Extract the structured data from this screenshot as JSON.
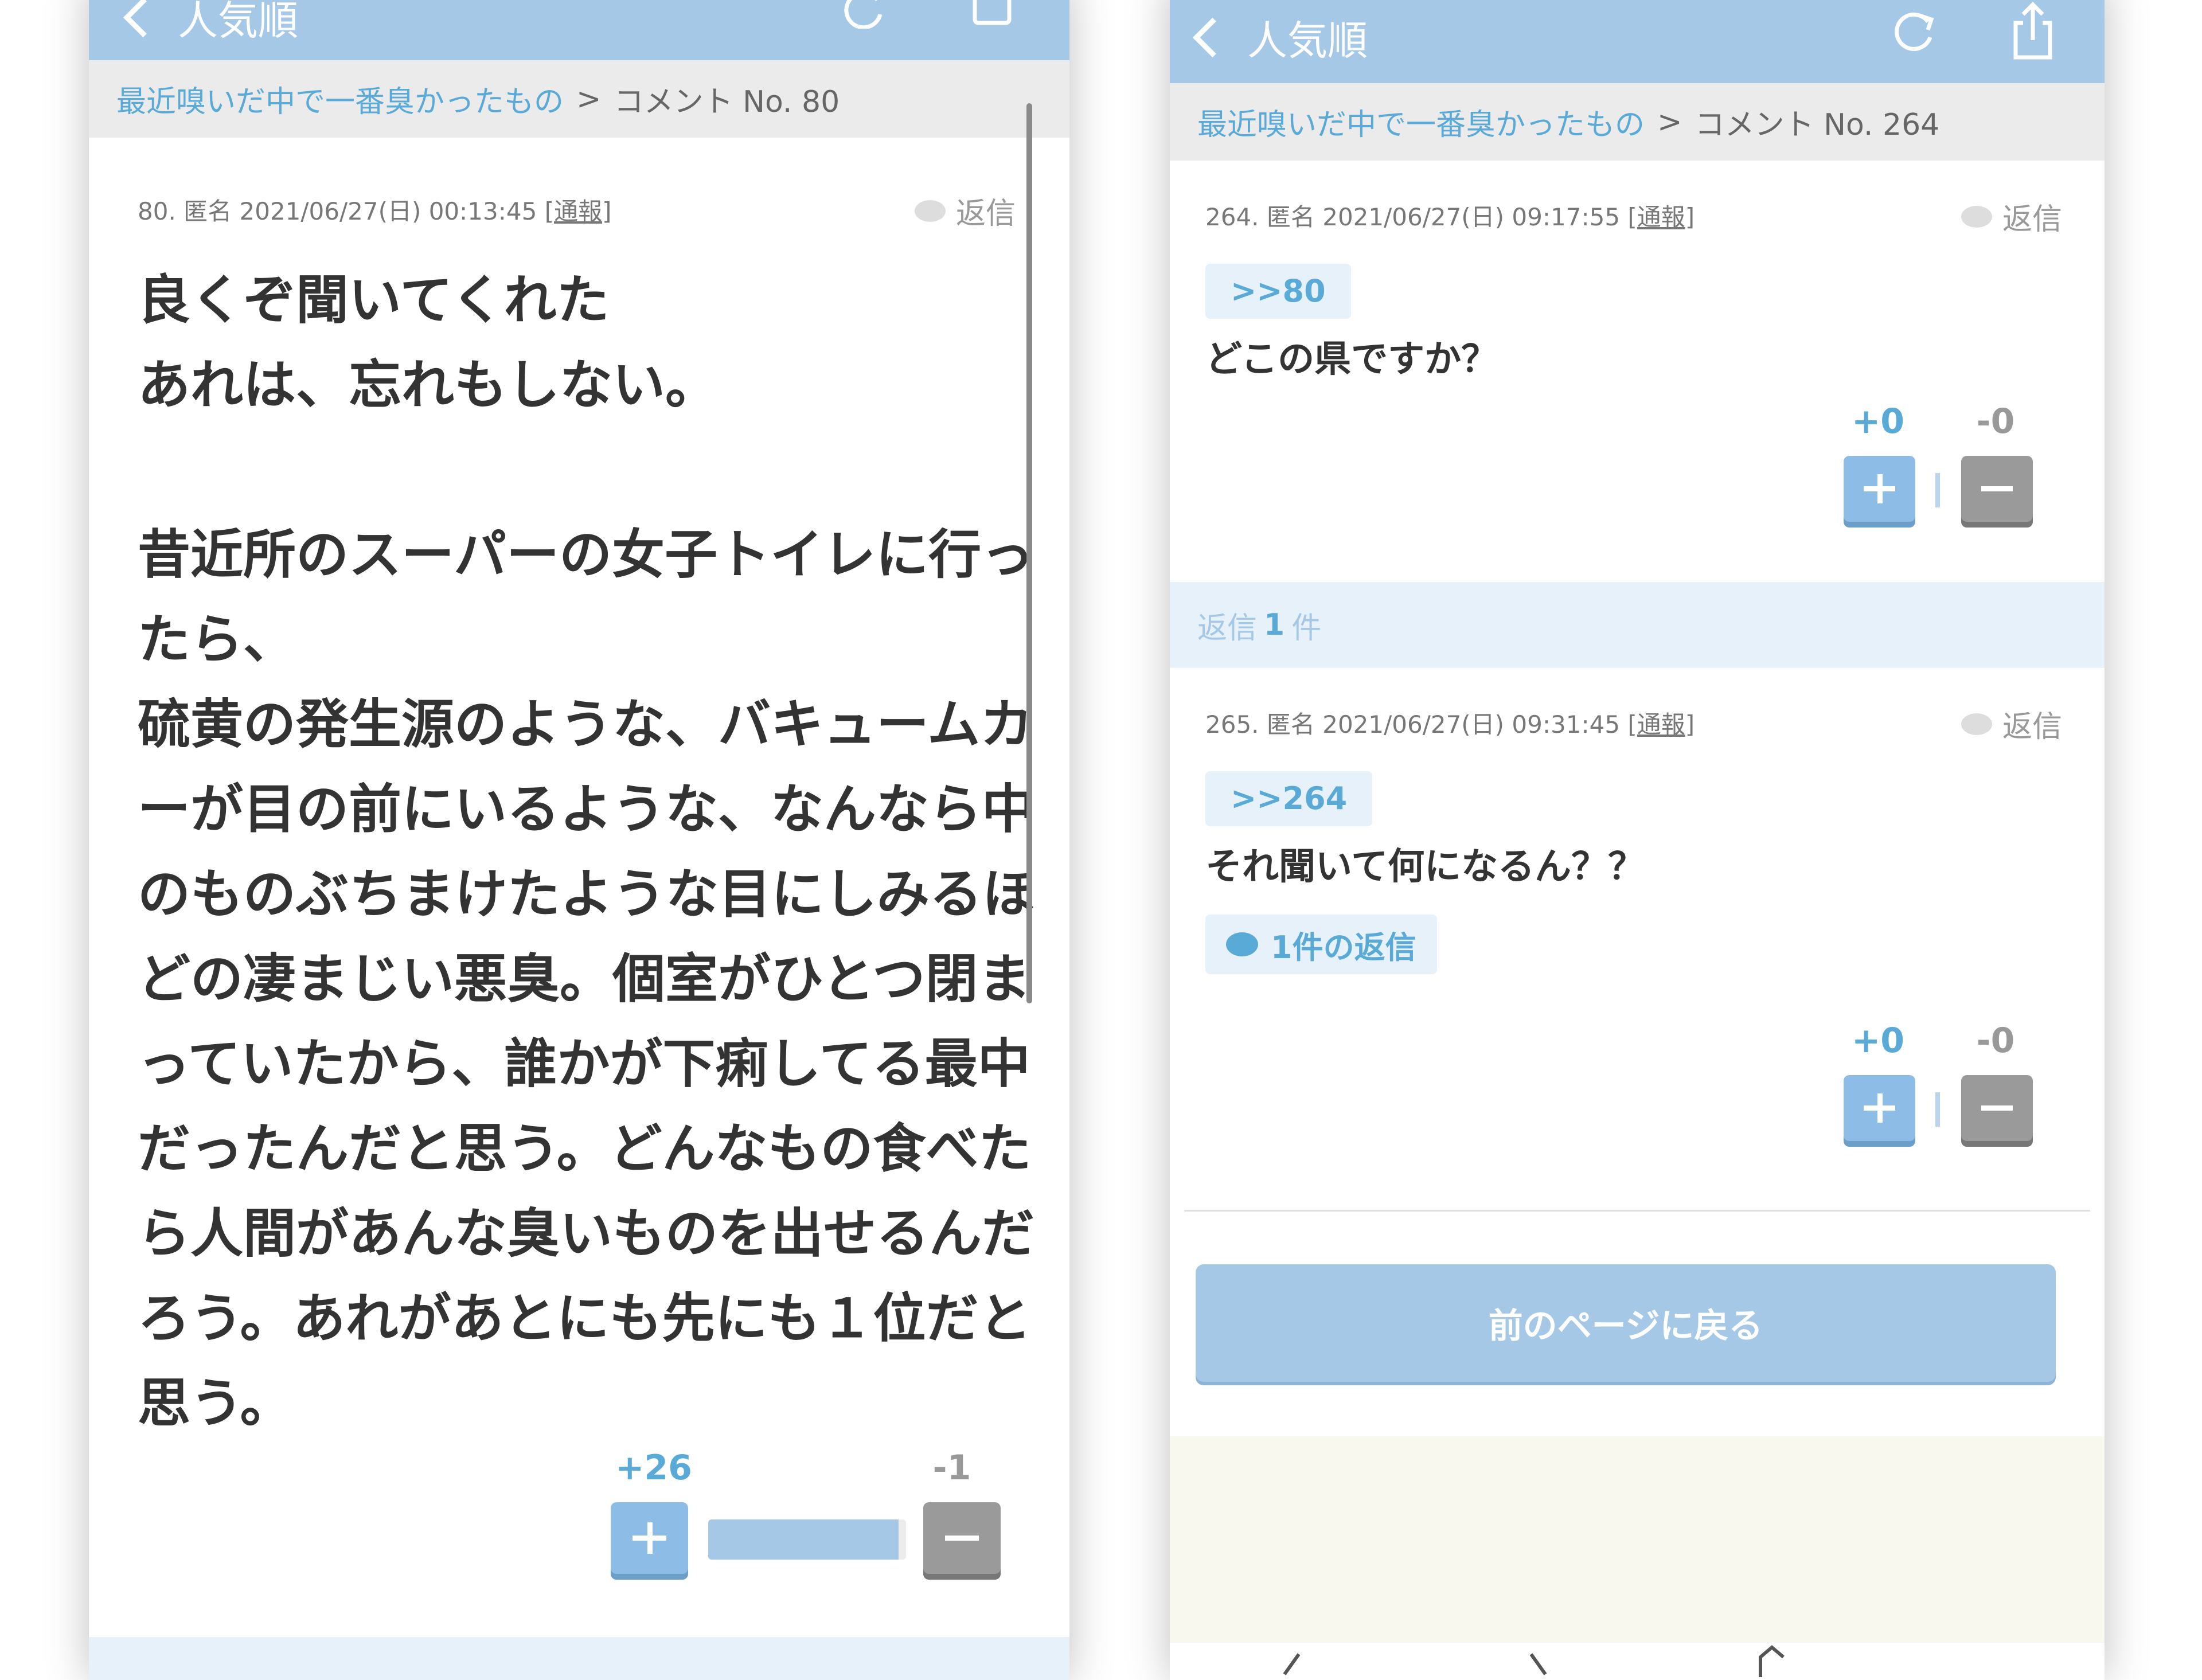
{
  "left": {
    "nav": {
      "back_label": "人気順"
    },
    "breadcrumb": {
      "topic": "最近嗅いだ中で一番臭かったもの",
      "separator": ">",
      "current": "コメント No. 80"
    },
    "comment": {
      "meta": "80. 匿名 2021/06/27(日) 00:13:45",
      "report": "[通報]",
      "reply": "返信",
      "lines": [
        "良くぞ聞いてくれた",
        "あれは、忘れもしない。",
        "",
        "昔近所のスーパーの女子トイレに行っ",
        "たら、",
        "硫黄の発生源のような、バキュームカ",
        "ーが目の前にいるような、なんなら中",
        "のものぶちまけたような目にしみるほ",
        "どの凄まじい悪臭。個室がひとつ閉ま",
        "っていたから、誰かが下痢してる最中",
        "だったんだと思う。どんなもの食べた",
        "ら人間があんな臭いものを出せるんだ",
        "ろう。あれがあとにも先にも１位だと",
        "思う。"
      ],
      "votes": {
        "plus": "+26",
        "minus": "-1",
        "plus_share": 0.963
      }
    }
  },
  "right": {
    "nav": {
      "back_label": "人気順"
    },
    "breadcrumb": {
      "topic": "最近嗅いだ中で一番臭かったもの",
      "separator": ">",
      "current": "コメント No. 264"
    },
    "comment": {
      "meta": "264. 匿名 2021/06/27(日) 09:17:55",
      "report": "[通報]",
      "reply": "返信",
      "ref": ">>80",
      "text": "どこの県ですか？",
      "votes": {
        "plus": "+0",
        "minus": "-0"
      }
    },
    "replies_header": {
      "prefix": "返信",
      "count": "1",
      "suffix": "件"
    },
    "reply": {
      "meta": "265. 匿名 2021/06/27(日) 09:31:45",
      "report": "[通報]",
      "reply": "返信",
      "ref": ">>264",
      "text": "それ聞いて何になるん？？",
      "reply_count_label": "1件の返信",
      "votes": {
        "plus": "+0",
        "minus": "-0"
      }
    },
    "back_button": "前のページに戻る"
  },
  "colors": {
    "accent": "#5aaad8",
    "navbar": "#a6c8e7",
    "light_blue": "#e6f1fa",
    "minus_gray": "#9a9a9a"
  }
}
